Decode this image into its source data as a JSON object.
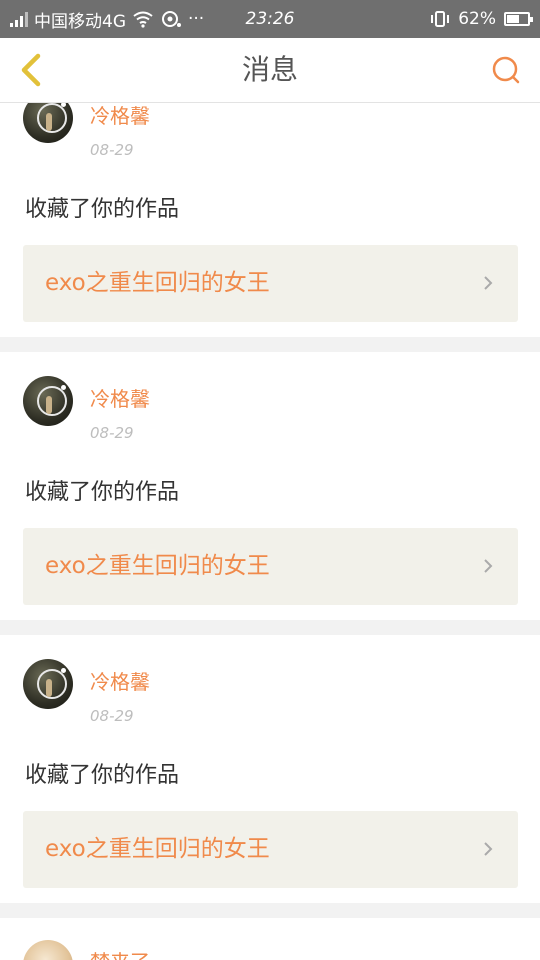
{
  "status_bar": {
    "carrier": "中国移动4G",
    "more": "···",
    "time": "23:26",
    "battery": "62%",
    "battery_level": 0.62
  },
  "nav": {
    "title": "消息",
    "back_icon": "chevron-left-icon",
    "search_icon": "search-icon",
    "accent": "#f08a4b"
  },
  "notifications": [
    {
      "user": "冷格馨",
      "date": "08-29",
      "action": "收藏了你的作品",
      "work_title": "exo之重生回归的女王"
    },
    {
      "user": "冷格馨",
      "date": "08-29",
      "action": "收藏了你的作品",
      "work_title": "exo之重生回归的女王"
    },
    {
      "user": "冷格馨",
      "date": "08-29",
      "action": "收藏了你的作品",
      "work_title": "exo之重生回归的女王"
    },
    {
      "user": "梦来了"
    }
  ]
}
